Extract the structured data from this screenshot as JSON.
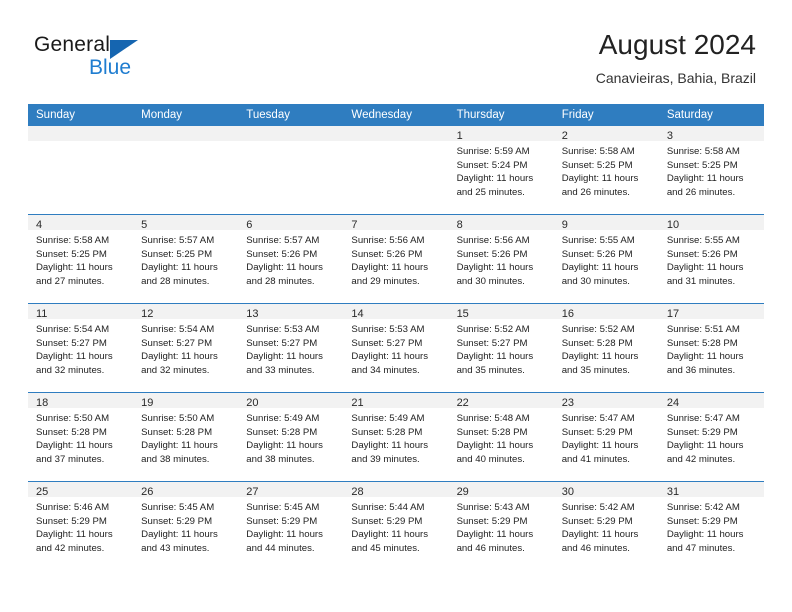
{
  "brand": {
    "word_one": "General",
    "word_two": "Blue",
    "triangle_icon": "triangle-icon",
    "accent_dark": "#1565b0",
    "accent_blue": "#1f7dd0"
  },
  "header": {
    "title": "August 2024",
    "subtitle": "Canavieiras, Bahia, Brazil"
  },
  "colors": {
    "header_row_bg": "#2f7dc0",
    "daynum_band_bg": "#f2f2f2",
    "week_separator": "#2f7dc0",
    "text": "#222222"
  },
  "weekday_headers": [
    "Sunday",
    "Monday",
    "Tuesday",
    "Wednesday",
    "Thursday",
    "Friday",
    "Saturday"
  ],
  "weeks": [
    [
      {
        "day": "",
        "lines": []
      },
      {
        "day": "",
        "lines": []
      },
      {
        "day": "",
        "lines": []
      },
      {
        "day": "",
        "lines": []
      },
      {
        "day": "1",
        "lines": [
          "Sunrise: 5:59 AM",
          "Sunset: 5:24 PM",
          "Daylight: 11 hours",
          "and 25 minutes."
        ]
      },
      {
        "day": "2",
        "lines": [
          "Sunrise: 5:58 AM",
          "Sunset: 5:25 PM",
          "Daylight: 11 hours",
          "and 26 minutes."
        ]
      },
      {
        "day": "3",
        "lines": [
          "Sunrise: 5:58 AM",
          "Sunset: 5:25 PM",
          "Daylight: 11 hours",
          "and 26 minutes."
        ]
      }
    ],
    [
      {
        "day": "4",
        "lines": [
          "Sunrise: 5:58 AM",
          "Sunset: 5:25 PM",
          "Daylight: 11 hours",
          "and 27 minutes."
        ]
      },
      {
        "day": "5",
        "lines": [
          "Sunrise: 5:57 AM",
          "Sunset: 5:25 PM",
          "Daylight: 11 hours",
          "and 28 minutes."
        ]
      },
      {
        "day": "6",
        "lines": [
          "Sunrise: 5:57 AM",
          "Sunset: 5:26 PM",
          "Daylight: 11 hours",
          "and 28 minutes."
        ]
      },
      {
        "day": "7",
        "lines": [
          "Sunrise: 5:56 AM",
          "Sunset: 5:26 PM",
          "Daylight: 11 hours",
          "and 29 minutes."
        ]
      },
      {
        "day": "8",
        "lines": [
          "Sunrise: 5:56 AM",
          "Sunset: 5:26 PM",
          "Daylight: 11 hours",
          "and 30 minutes."
        ]
      },
      {
        "day": "9",
        "lines": [
          "Sunrise: 5:55 AM",
          "Sunset: 5:26 PM",
          "Daylight: 11 hours",
          "and 30 minutes."
        ]
      },
      {
        "day": "10",
        "lines": [
          "Sunrise: 5:55 AM",
          "Sunset: 5:26 PM",
          "Daylight: 11 hours",
          "and 31 minutes."
        ]
      }
    ],
    [
      {
        "day": "11",
        "lines": [
          "Sunrise: 5:54 AM",
          "Sunset: 5:27 PM",
          "Daylight: 11 hours",
          "and 32 minutes."
        ]
      },
      {
        "day": "12",
        "lines": [
          "Sunrise: 5:54 AM",
          "Sunset: 5:27 PM",
          "Daylight: 11 hours",
          "and 32 minutes."
        ]
      },
      {
        "day": "13",
        "lines": [
          "Sunrise: 5:53 AM",
          "Sunset: 5:27 PM",
          "Daylight: 11 hours",
          "and 33 minutes."
        ]
      },
      {
        "day": "14",
        "lines": [
          "Sunrise: 5:53 AM",
          "Sunset: 5:27 PM",
          "Daylight: 11 hours",
          "and 34 minutes."
        ]
      },
      {
        "day": "15",
        "lines": [
          "Sunrise: 5:52 AM",
          "Sunset: 5:27 PM",
          "Daylight: 11 hours",
          "and 35 minutes."
        ]
      },
      {
        "day": "16",
        "lines": [
          "Sunrise: 5:52 AM",
          "Sunset: 5:28 PM",
          "Daylight: 11 hours",
          "and 35 minutes."
        ]
      },
      {
        "day": "17",
        "lines": [
          "Sunrise: 5:51 AM",
          "Sunset: 5:28 PM",
          "Daylight: 11 hours",
          "and 36 minutes."
        ]
      }
    ],
    [
      {
        "day": "18",
        "lines": [
          "Sunrise: 5:50 AM",
          "Sunset: 5:28 PM",
          "Daylight: 11 hours",
          "and 37 minutes."
        ]
      },
      {
        "day": "19",
        "lines": [
          "Sunrise: 5:50 AM",
          "Sunset: 5:28 PM",
          "Daylight: 11 hours",
          "and 38 minutes."
        ]
      },
      {
        "day": "20",
        "lines": [
          "Sunrise: 5:49 AM",
          "Sunset: 5:28 PM",
          "Daylight: 11 hours",
          "and 38 minutes."
        ]
      },
      {
        "day": "21",
        "lines": [
          "Sunrise: 5:49 AM",
          "Sunset: 5:28 PM",
          "Daylight: 11 hours",
          "and 39 minutes."
        ]
      },
      {
        "day": "22",
        "lines": [
          "Sunrise: 5:48 AM",
          "Sunset: 5:28 PM",
          "Daylight: 11 hours",
          "and 40 minutes."
        ]
      },
      {
        "day": "23",
        "lines": [
          "Sunrise: 5:47 AM",
          "Sunset: 5:29 PM",
          "Daylight: 11 hours",
          "and 41 minutes."
        ]
      },
      {
        "day": "24",
        "lines": [
          "Sunrise: 5:47 AM",
          "Sunset: 5:29 PM",
          "Daylight: 11 hours",
          "and 42 minutes."
        ]
      }
    ],
    [
      {
        "day": "25",
        "lines": [
          "Sunrise: 5:46 AM",
          "Sunset: 5:29 PM",
          "Daylight: 11 hours",
          "and 42 minutes."
        ]
      },
      {
        "day": "26",
        "lines": [
          "Sunrise: 5:45 AM",
          "Sunset: 5:29 PM",
          "Daylight: 11 hours",
          "and 43 minutes."
        ]
      },
      {
        "day": "27",
        "lines": [
          "Sunrise: 5:45 AM",
          "Sunset: 5:29 PM",
          "Daylight: 11 hours",
          "and 44 minutes."
        ]
      },
      {
        "day": "28",
        "lines": [
          "Sunrise: 5:44 AM",
          "Sunset: 5:29 PM",
          "Daylight: 11 hours",
          "and 45 minutes."
        ]
      },
      {
        "day": "29",
        "lines": [
          "Sunrise: 5:43 AM",
          "Sunset: 5:29 PM",
          "Daylight: 11 hours",
          "and 46 minutes."
        ]
      },
      {
        "day": "30",
        "lines": [
          "Sunrise: 5:42 AM",
          "Sunset: 5:29 PM",
          "Daylight: 11 hours",
          "and 46 minutes."
        ]
      },
      {
        "day": "31",
        "lines": [
          "Sunrise: 5:42 AM",
          "Sunset: 5:29 PM",
          "Daylight: 11 hours",
          "and 47 minutes."
        ]
      }
    ]
  ]
}
